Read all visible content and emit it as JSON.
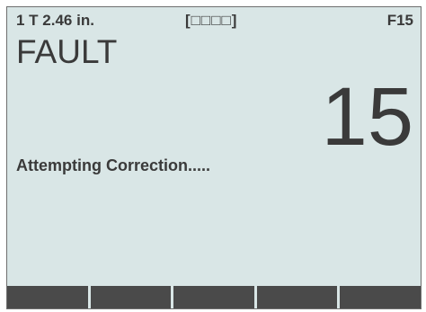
{
  "status_bar": {
    "left": "1 T 2.46 in.",
    "center": "[□□□□]",
    "right": "F15"
  },
  "mode_title": "FAULT",
  "fault_number": "15",
  "message": "Attempting Correction.....",
  "softkeys": [
    "",
    "",
    "",
    "",
    ""
  ],
  "colors": {
    "screen_background": "#d9e6e6",
    "text": "#3a3a3a",
    "softkey": "#4a4a4a"
  }
}
